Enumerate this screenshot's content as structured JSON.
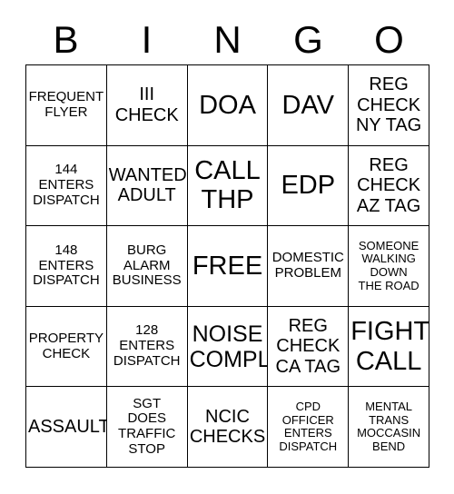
{
  "card": {
    "header_letters": [
      "B",
      "I",
      "N",
      "G",
      "O"
    ],
    "rows": [
      [
        {
          "text": "FREQUENT\nFLYER",
          "size": "sm"
        },
        {
          "text": "III\nCHECK",
          "size": "md"
        },
        {
          "text": "DOA",
          "size": "xl"
        },
        {
          "text": "DAV",
          "size": "xl"
        },
        {
          "text": "REG\nCHECK\nNY TAG",
          "size": "md"
        }
      ],
      [
        {
          "text": "144\nENTERS\nDISPATCH",
          "size": "sm"
        },
        {
          "text": "WANTED\nADULT",
          "size": "md"
        },
        {
          "text": "CALL\nTHP",
          "size": "xl"
        },
        {
          "text": "EDP",
          "size": "xl"
        },
        {
          "text": "REG\nCHECK\nAZ TAG",
          "size": "md"
        }
      ],
      [
        {
          "text": "148\nENTERS\nDISPATCH",
          "size": "sm"
        },
        {
          "text": "BURG\nALARM\nBUSINESS",
          "size": "sm"
        },
        {
          "text": "FREE",
          "size": "xl"
        },
        {
          "text": "DOMESTIC\nPROBLEM",
          "size": "sm"
        },
        {
          "text": "SOMEONE\nWALKING\nDOWN\nTHE ROAD",
          "size": "xs"
        }
      ],
      [
        {
          "text": "PROPERTY\nCHECK",
          "size": "sm"
        },
        {
          "text": "128\nENTERS\nDISPATCH",
          "size": "sm"
        },
        {
          "text": "NOISE\nCOMPL",
          "size": "lg"
        },
        {
          "text": "REG\nCHECK\nCA TAG",
          "size": "md"
        },
        {
          "text": "FIGHT\nCALL",
          "size": "xl"
        }
      ],
      [
        {
          "text": "ASSAULT",
          "size": "md"
        },
        {
          "text": "SGT\nDOES\nTRAFFIC\nSTOP",
          "size": "sm"
        },
        {
          "text": "NCIC\nCHECKS",
          "size": "md"
        },
        {
          "text": "CPD\nOFFICER\nENTERS\nDISPATCH",
          "size": "xs"
        },
        {
          "text": "MENTAL\nTRANS\nMOCCASIN\nBEND",
          "size": "xs"
        }
      ]
    ]
  },
  "colors": {
    "ink": "#000000",
    "background": "#ffffff",
    "grid_line": "#000000"
  }
}
